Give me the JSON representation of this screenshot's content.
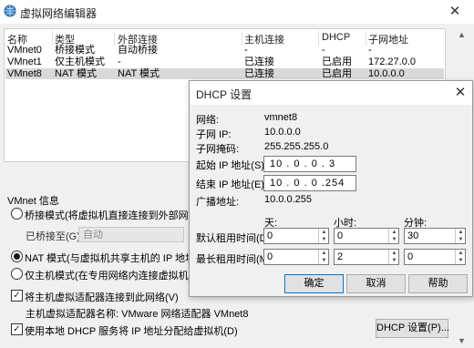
{
  "window": {
    "title": "虚拟网络编辑器",
    "close_glyph": "✕"
  },
  "network_table": {
    "columns": [
      "名称",
      "类型",
      "外部连接",
      "主机连接",
      "DHCP",
      "子网地址"
    ],
    "rows": [
      [
        "VMnet0",
        "桥接模式",
        "自动桥接",
        "-",
        "-",
        "-"
      ],
      [
        "VMnet1",
        "仅主机模式",
        "-",
        "已连接",
        "已启用",
        "172.27.0.0"
      ],
      [
        "VMnet8",
        "NAT 模式",
        "NAT 模式",
        "已连接",
        "已启用",
        "10.0.0.0"
      ]
    ],
    "selected_index": 2
  },
  "vmnet_info": {
    "group_label": "VMnet 信息",
    "bridge_mode_label": "桥接模式(将虚拟机直接连接到外部网络)(B)",
    "bridge_to_label": "已桥接至(G):",
    "bridge_to_value": "自动",
    "nat_mode_label": "NAT 模式(与虚拟机共享主机的 IP 地址)(N)",
    "host_only_label": "仅主机模式(在专用网络内连接虚拟机)(H)",
    "selected_mode": "nat",
    "connect_adapter_label": "将主机虚拟适配器连接到此网络(V)",
    "connect_adapter_checked": true,
    "adapter_name_label": "主机虚拟适配器名称: VMware 网络适配器 VMnet8",
    "use_dhcp_label": "使用本地 DHCP 服务将 IP 地址分配给虚拟机(D)",
    "use_dhcp_checked": true,
    "dhcp_settings_button": "DHCP 设置(P)..."
  },
  "dhcp_dialog": {
    "title": "DHCP 设置",
    "close_glyph": "✕",
    "network_label": "网络:",
    "network_value": "vmnet8",
    "subnet_ip_label": "子网 IP:",
    "subnet_ip_value": "10.0.0.0",
    "subnet_mask_label": "子网掩码:",
    "subnet_mask_value": "255.255.255.0",
    "start_ip_label": "起始 IP 地址(S):",
    "start_ip_value": "10 . 0 . 0 . 3",
    "end_ip_label": "结束 IP 地址(E):",
    "end_ip_value": "10 . 0 . 0 .254",
    "broadcast_label": "广播地址:",
    "broadcast_value": "10.0.0.255",
    "days_header": "天:",
    "hours_header": "小时:",
    "minutes_header": "分钟:",
    "default_lease_label": "默认租用时间(D):",
    "default_lease": {
      "days": "0",
      "hours": "0",
      "minutes": "30"
    },
    "max_lease_label": "最长租用时间(M):",
    "max_lease": {
      "days": "0",
      "hours": "2",
      "minutes": "0"
    },
    "ok_button": "确定",
    "cancel_button": "取消",
    "help_button": "帮助"
  }
}
